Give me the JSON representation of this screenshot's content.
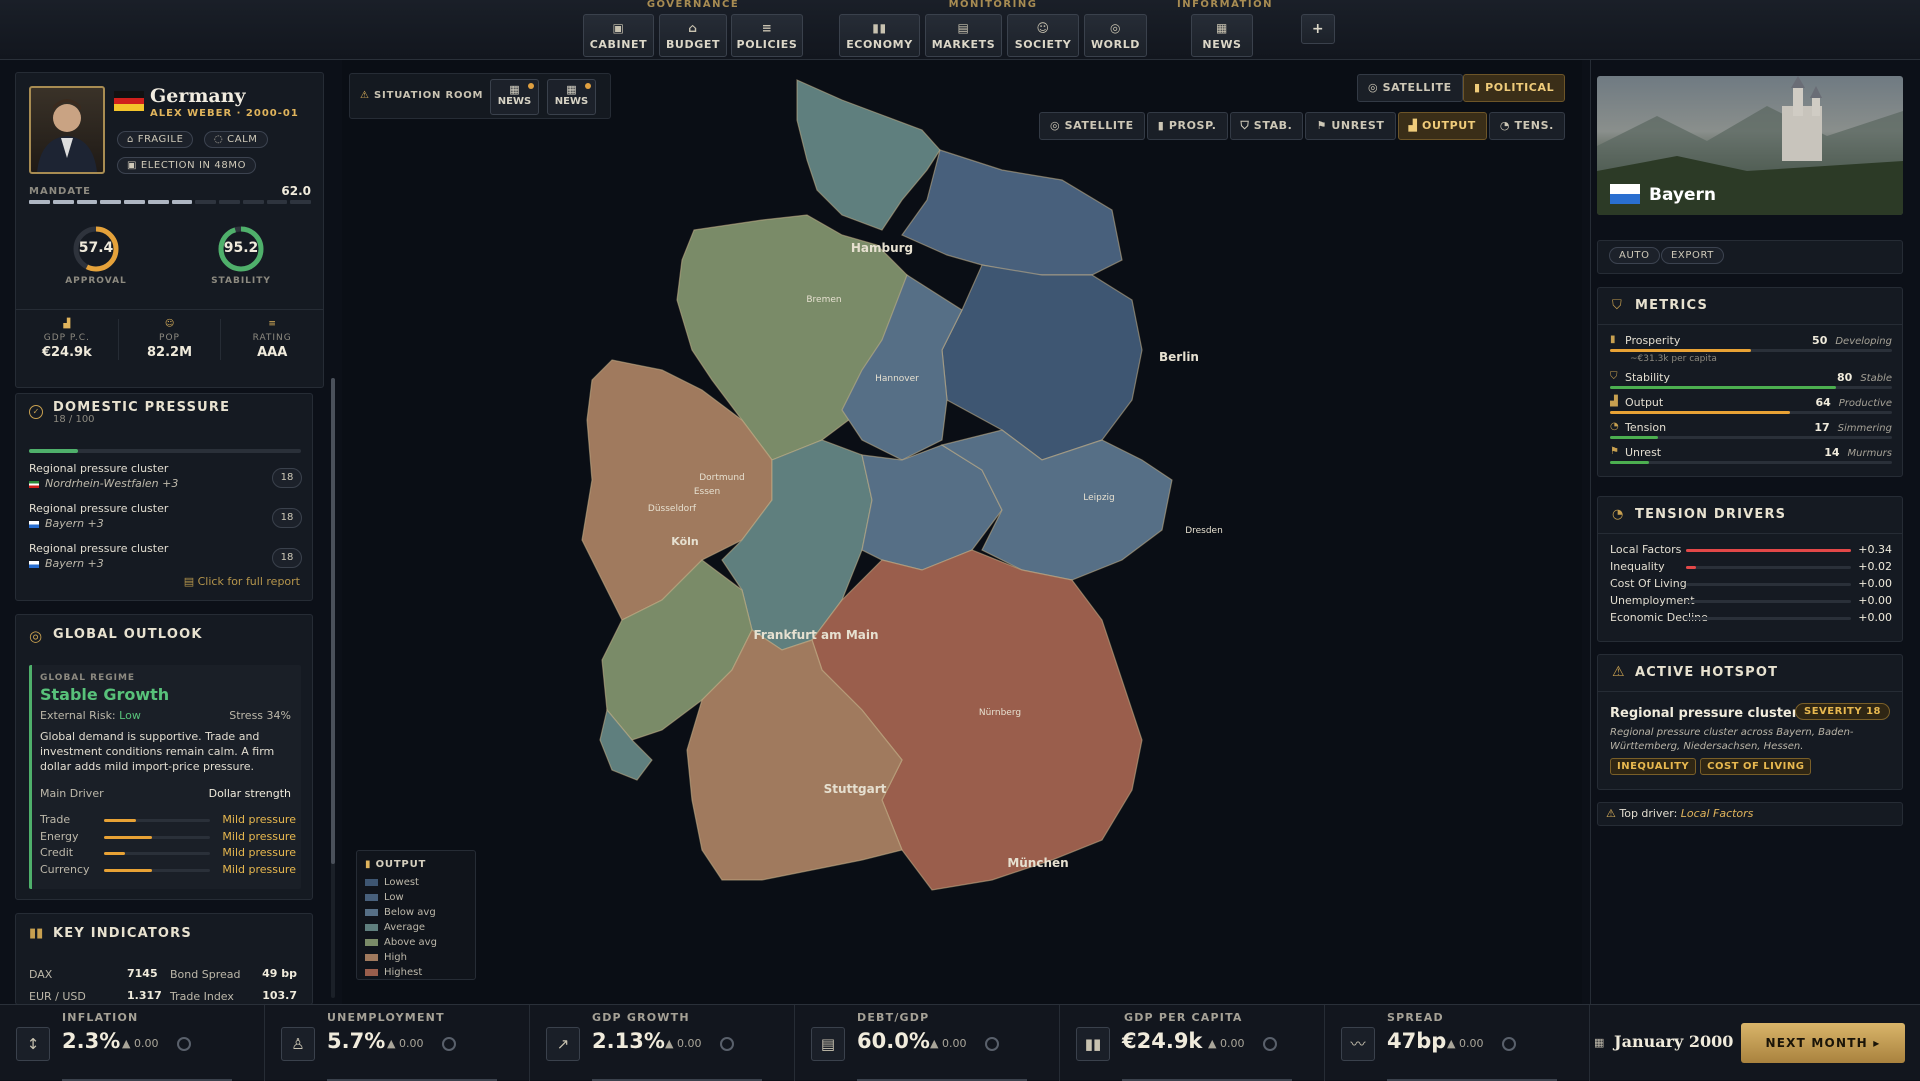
{
  "topnav": {
    "groups": {
      "governance": "GOVERNANCE",
      "monitoring": "MONITORING",
      "information": "INFORMATION"
    },
    "buttons": {
      "cabinet": "CABINET",
      "budget": "BUDGET",
      "policies": "POLICIES",
      "economy": "ECONOMY",
      "markets": "MARKETS",
      "society": "SOCIETY",
      "world": "WORLD",
      "news": "NEWS"
    },
    "extra_icon": "plus-icon"
  },
  "country": {
    "name": "Germany",
    "leader": "ALEX WEBER · 2000-01",
    "chips": {
      "fragile": "FRAGILE",
      "calm": "CALM",
      "election": "ELECTION IN 48MO"
    },
    "mandate_label": "MANDATE",
    "mandate_value": "62.0",
    "mandate_fraction": 0.62,
    "approval": "57.4",
    "approval_label": "APPROVAL",
    "approval_fraction": 0.574,
    "stability": "95.2",
    "stability_label": "STABILITY",
    "stability_fraction": 0.952,
    "stats": [
      {
        "label": "GDP P.C.",
        "value": "€24.9k"
      },
      {
        "label": "POP",
        "value": "82.2M"
      },
      {
        "label": "RATING",
        "value": "AAA"
      }
    ]
  },
  "domestic": {
    "title": "DOMESTIC PRESSURE",
    "sub": "18 / 100",
    "fraction": 0.18,
    "items": [
      {
        "title": "Regional pressure cluster",
        "region": "Nordrhein-Westfalen +3",
        "score": "18"
      },
      {
        "title": "Regional pressure cluster",
        "region": "Bayern +3",
        "score": "18"
      },
      {
        "title": "Regional pressure cluster",
        "region": "Bayern +3",
        "score": "18"
      }
    ],
    "link": "Click for full report"
  },
  "global": {
    "title": "GLOBAL OUTLOOK",
    "regime_label": "GLOBAL REGIME",
    "regime": "Stable Growth",
    "risk_label": "External Risk:",
    "risk_value": "Low",
    "stress": "Stress 34%",
    "desc": "Global demand is supportive. Trade and investment conditions remain calm. A firm dollar adds mild import-price pressure.",
    "driver_label": "Main Driver",
    "driver_value": "Dollar strength",
    "pressures": [
      {
        "label": "Trade",
        "value": "Mild pressure",
        "fraction": 0.3
      },
      {
        "label": "Energy",
        "value": "Mild pressure",
        "fraction": 0.45
      },
      {
        "label": "Credit",
        "value": "Mild pressure",
        "fraction": 0.2
      },
      {
        "label": "Currency",
        "value": "Mild pressure",
        "fraction": 0.45
      }
    ]
  },
  "key": {
    "title": "KEY INDICATORS",
    "rows": [
      {
        "a": "DAX",
        "av": "7145",
        "b": "Bond Spread",
        "bv": "49 bp"
      },
      {
        "a": "EUR / USD",
        "av": "1.317",
        "b": "Trade Index",
        "bv": "103.7"
      }
    ]
  },
  "map": {
    "situation": "SITUATION ROOM",
    "news1": "NEWS",
    "news2": "NEWS",
    "view_satellite": "SATELLITE",
    "view_political": "POLITICAL",
    "layers": [
      "SATELLITE",
      "PROSP.",
      "STAB.",
      "UNREST",
      "OUTPUT",
      "TENS."
    ],
    "cities": {
      "hamburg": "Hamburg",
      "bremen": "Bremen",
      "hannover": "Hannover",
      "berlin": "Berlin",
      "dortmund": "Dortmund",
      "essen": "Essen",
      "dusseldorf": "Düsseldorf",
      "koln": "Köln",
      "leipzig": "Leipzig",
      "dresden": "Dresden",
      "frankfurt": "Frankfurt am Main",
      "nurnberg": "Nürnberg",
      "stuttgart": "Stuttgart",
      "munchen": "München"
    },
    "legend": {
      "title": "OUTPUT",
      "items": [
        {
          "label": "Lowest",
          "color": "#3e5672"
        },
        {
          "label": "Low",
          "color": "#48607c"
        },
        {
          "label": "Below avg",
          "color": "#566f86"
        },
        {
          "label": "Average",
          "color": "#5f7f7e"
        },
        {
          "label": "Above avg",
          "color": "#7a8b68"
        },
        {
          "label": "High",
          "color": "#a07a5e"
        },
        {
          "label": "Highest",
          "color": "#9a5e4c"
        }
      ]
    }
  },
  "region": {
    "name": "Bayern",
    "auto": "AUTO",
    "export": "EXPORT",
    "metrics_title": "METRICS",
    "metrics": [
      {
        "label": "Prosperity",
        "value": "50",
        "tag": "Developing",
        "fraction": 0.5,
        "color": "#e8a235",
        "note": "~€31.3k per capita"
      },
      {
        "label": "Stability",
        "value": "80",
        "tag": "Stable",
        "fraction": 0.8,
        "color": "#4caf50",
        "note": ""
      },
      {
        "label": "Output",
        "value": "64",
        "tag": "Productive",
        "fraction": 0.64,
        "color": "#e8a235",
        "note": ""
      },
      {
        "label": "Tension",
        "value": "17",
        "tag": "Simmering",
        "fraction": 0.17,
        "color": "#4caf50",
        "note": ""
      },
      {
        "label": "Unrest",
        "value": "14",
        "tag": "Murmurs",
        "fraction": 0.14,
        "color": "#4caf50",
        "note": ""
      }
    ],
    "drivers_title": "TENSION DRIVERS",
    "drivers": [
      {
        "label": "Local Factors",
        "value": "+0.34",
        "fraction": 1.0
      },
      {
        "label": "Inequality",
        "value": "+0.02",
        "fraction": 0.06
      },
      {
        "label": "Cost Of Living",
        "value": "+0.00",
        "fraction": 0
      },
      {
        "label": "Unemployment",
        "value": "+0.00",
        "fraction": 0
      },
      {
        "label": "Economic Decline",
        "value": "+0.00",
        "fraction": 0
      }
    ],
    "hotspot_title": "ACTIVE HOTSPOT",
    "hotspot_name": "Regional pressure cluster",
    "severity": "SEVERITY 18",
    "hotspot_desc": "Regional pressure cluster across Bayern, Baden-Württemberg, Niedersachsen, Hessen.",
    "tags": [
      "INEQUALITY",
      "COST OF LIVING"
    ],
    "top_driver_label": "Top driver:",
    "top_driver": "Local Factors"
  },
  "bottom": {
    "stats": [
      {
        "label": "INFLATION",
        "value": "2.3%",
        "delta": "▲ 0.00",
        "icon": "thermometer-icon"
      },
      {
        "label": "UNEMPLOYMENT",
        "value": "5.7%",
        "delta": "▲ 0.00",
        "icon": "person-icon"
      },
      {
        "label": "GDP GROWTH",
        "value": "2.13%",
        "delta": "▲ 0.00",
        "icon": "trend-icon"
      },
      {
        "label": "DEBT/GDP",
        "value": "60.0%",
        "delta": "▲ 0.00",
        "icon": "ledger-icon"
      },
      {
        "label": "GDP PER CAPITA",
        "value": "€24.9k",
        "delta": "▲ 0.00",
        "icon": "bar-chart-icon"
      },
      {
        "label": "SPREAD",
        "value": "47bp",
        "delta": "▲ 0.00",
        "icon": "wave-icon"
      }
    ],
    "date": "January 2000",
    "next": "NEXT MONTH"
  }
}
